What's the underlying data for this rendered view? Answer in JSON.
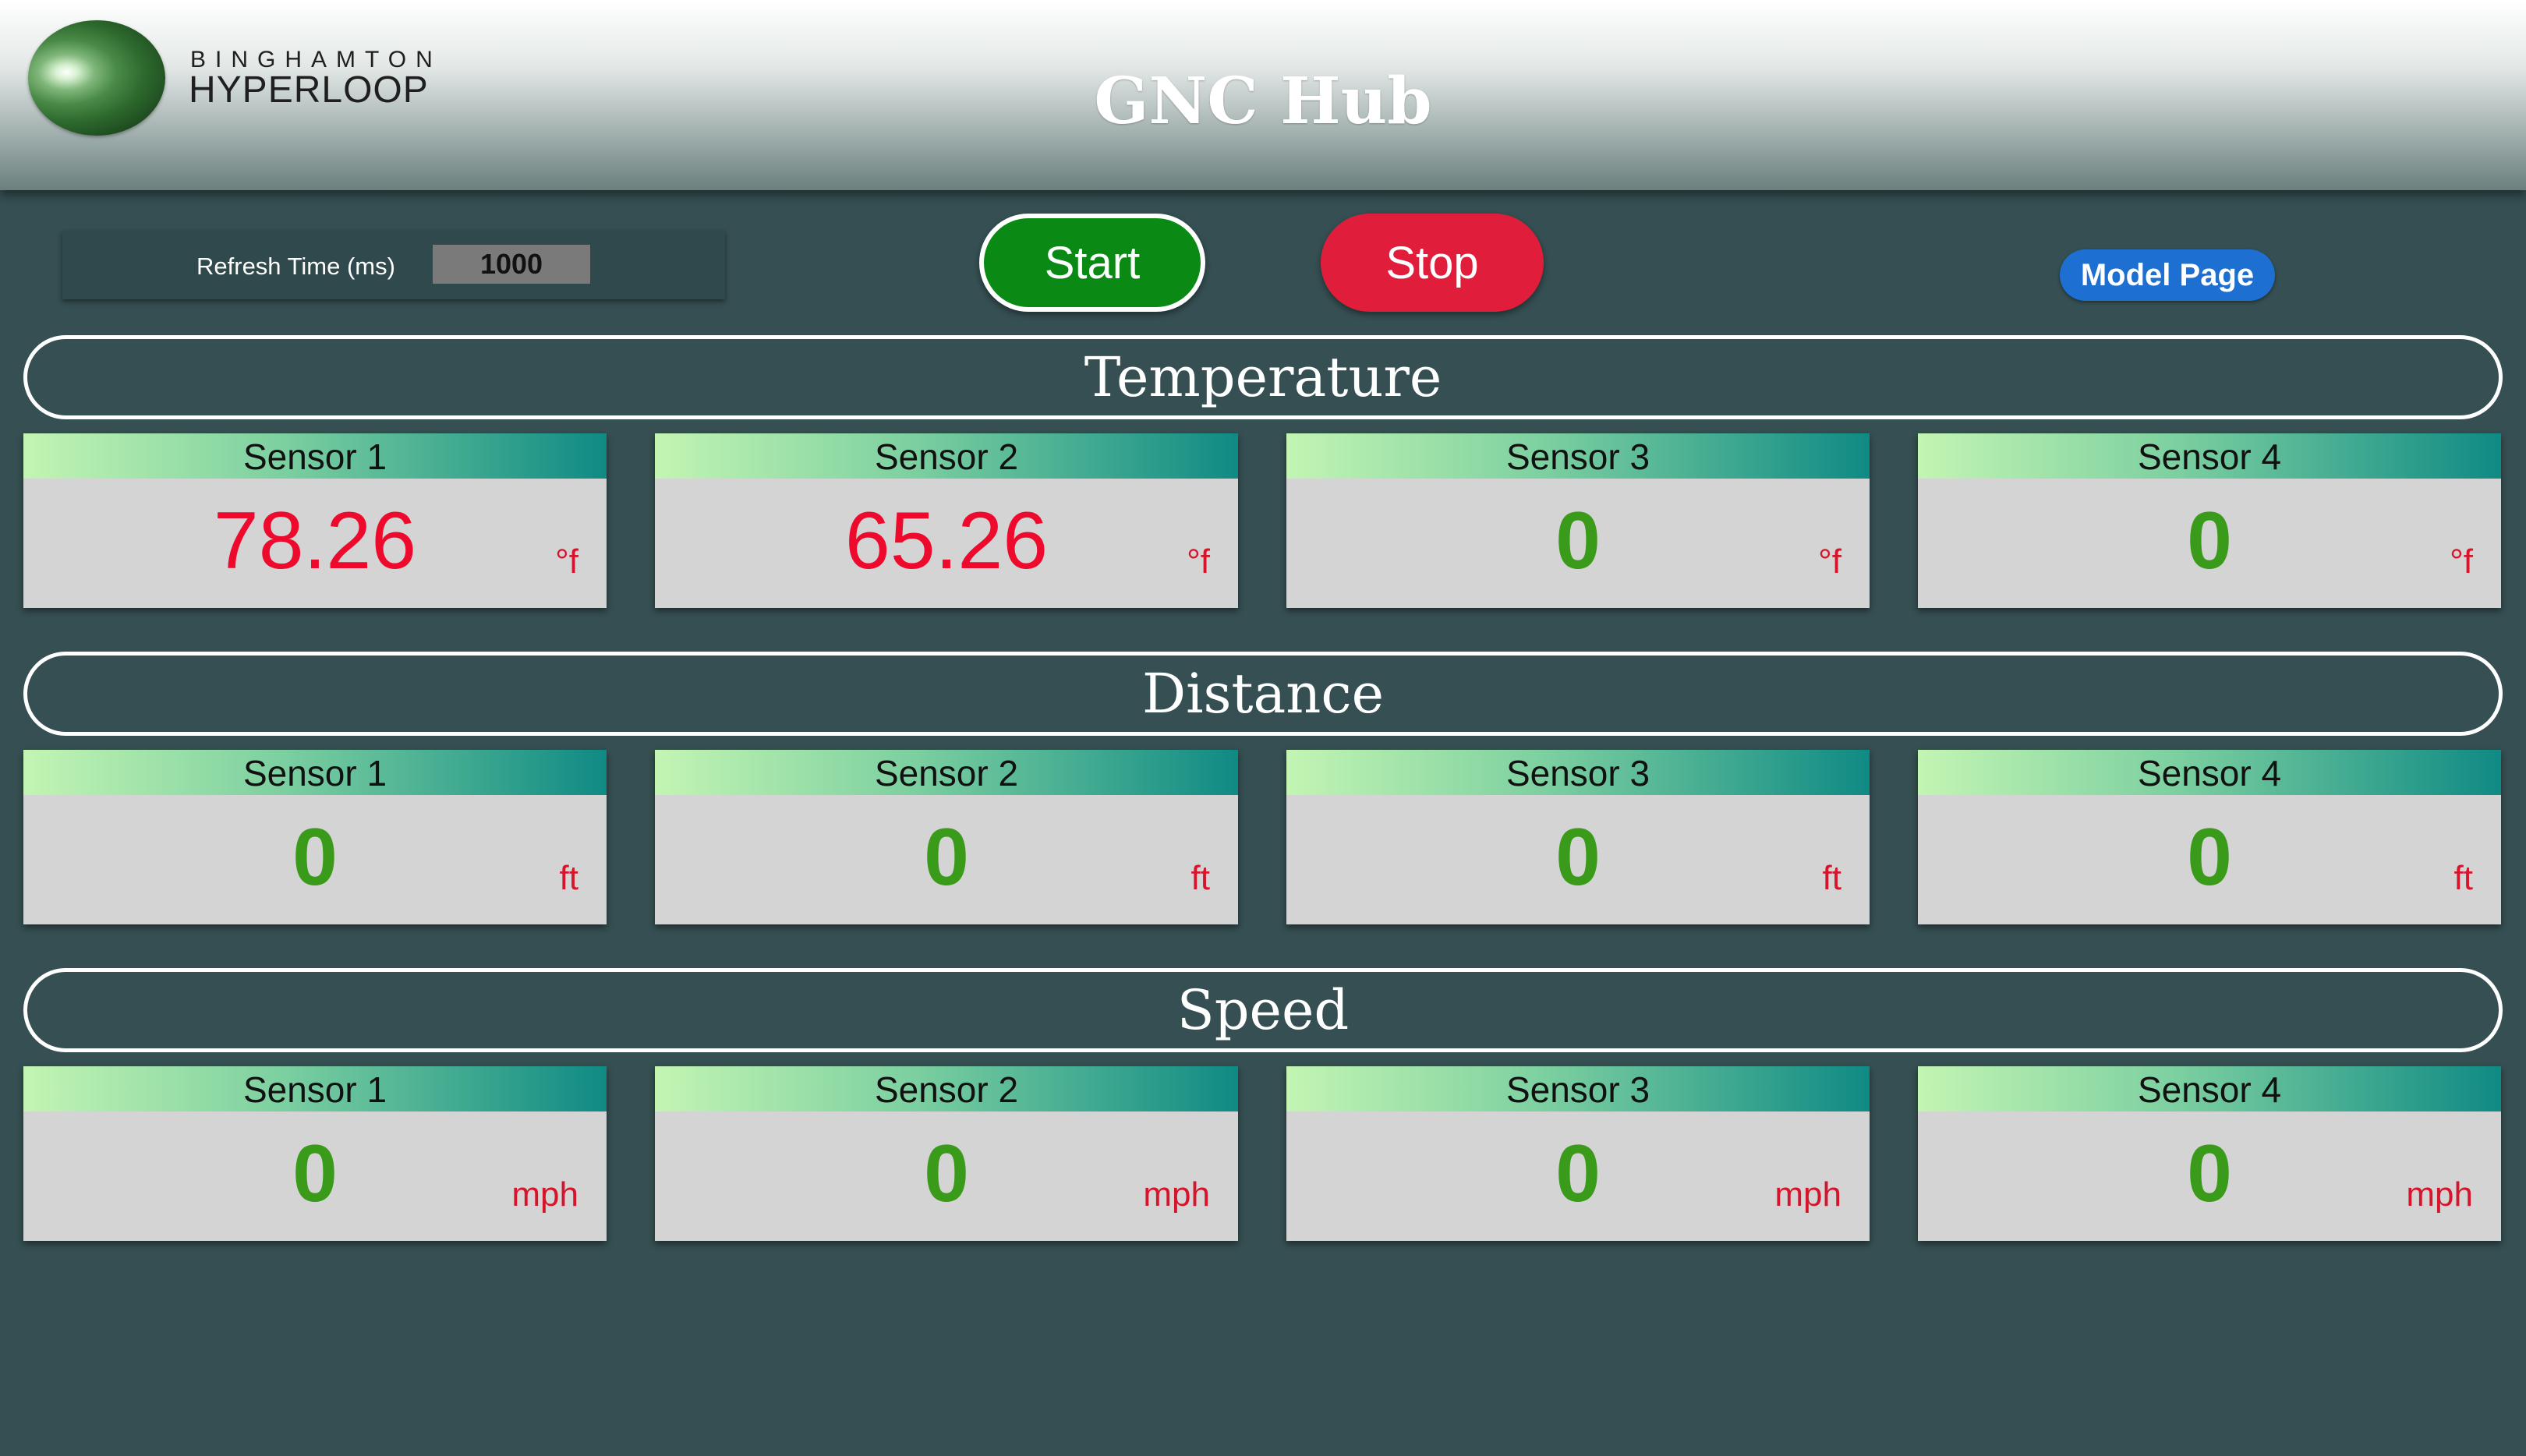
{
  "header": {
    "logo_small": "BINGHAMTON",
    "logo_big": "HYPERLOOP",
    "title": "GNC Hub"
  },
  "controls": {
    "refresh_label": "Refresh Time (ms)",
    "refresh_value": "1000",
    "start_label": "Start",
    "stop_label": "Stop",
    "model_label": "Model Page"
  },
  "colors": {
    "background": "#354f52",
    "start": "#0a8a14",
    "stop": "#e01e3c",
    "model": "#1d6fd2",
    "value_alert": "#ee0a2c",
    "value_ok": "#3a9a19",
    "unit": "#d5152c"
  },
  "sections": [
    {
      "title": "Temperature",
      "sensors": [
        {
          "label": "Sensor 1",
          "value": "78.26",
          "unit": "°f",
          "status": "alert"
        },
        {
          "label": "Sensor 2",
          "value": "65.26",
          "unit": "°f",
          "status": "alert"
        },
        {
          "label": "Sensor 3",
          "value": "0",
          "unit": "°f",
          "status": "ok"
        },
        {
          "label": "Sensor 4",
          "value": "0",
          "unit": "°f",
          "status": "ok"
        }
      ]
    },
    {
      "title": "Distance",
      "sensors": [
        {
          "label": "Sensor 1",
          "value": "0",
          "unit": "ft",
          "status": "ok"
        },
        {
          "label": "Sensor 2",
          "value": "0",
          "unit": "ft",
          "status": "ok"
        },
        {
          "label": "Sensor 3",
          "value": "0",
          "unit": "ft",
          "status": "ok"
        },
        {
          "label": "Sensor 4",
          "value": "0",
          "unit": "ft",
          "status": "ok"
        }
      ]
    },
    {
      "title": "Speed",
      "sensors": [
        {
          "label": "Sensor 1",
          "value": "0",
          "unit": "mph",
          "status": "ok"
        },
        {
          "label": "Sensor 2",
          "value": "0",
          "unit": "mph",
          "status": "ok"
        },
        {
          "label": "Sensor 3",
          "value": "0",
          "unit": "mph",
          "status": "ok"
        },
        {
          "label": "Sensor 4",
          "value": "0",
          "unit": "mph",
          "status": "ok"
        }
      ]
    }
  ]
}
